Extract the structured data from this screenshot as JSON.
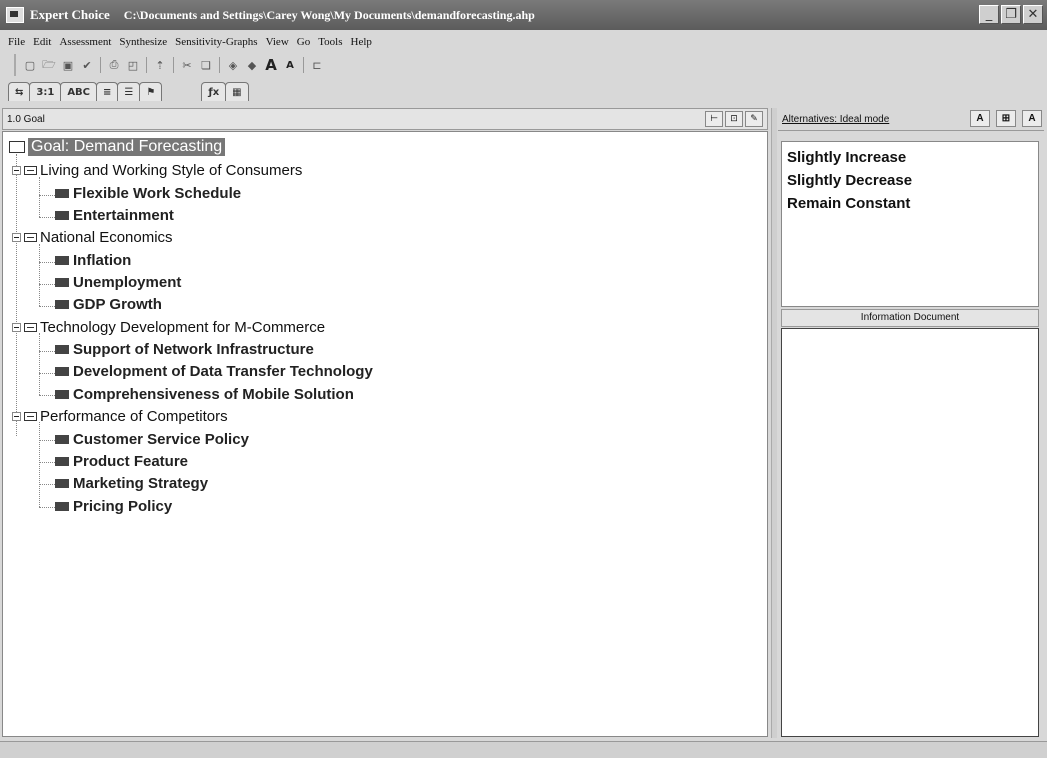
{
  "window": {
    "app_name": "Expert Choice",
    "file_path": "C:\\Documents and Settings\\Carey Wong\\My Documents\\demandforecasting.ahp",
    "buttons": {
      "minimize": "_",
      "restore": "❐",
      "close": "✕"
    }
  },
  "menu": [
    "File",
    "Edit",
    "Assessment",
    "Synthesize",
    "Sensitivity-Graphs",
    "View",
    "Go",
    "Tools",
    "Help"
  ],
  "toolbar_icons": [
    "new-icon",
    "open-icon",
    "save-icon",
    "save-as-icon",
    "print-icon",
    "print-preview-icon",
    "move-up-icon",
    "cut-icon",
    "copy-icon",
    "paste-icon",
    "compare-icon",
    "increase-font-icon",
    "decrease-font-icon",
    "insert-node-icon"
  ],
  "tabs": [
    {
      "label": "⇆",
      "icon": "hierarchy-tab-icon"
    },
    {
      "label": "3:1",
      "icon": ""
    },
    {
      "label": "ABC",
      "icon": ""
    },
    {
      "label": "≡",
      "icon": ""
    },
    {
      "label": "☰",
      "icon": ""
    },
    {
      "label": "⚑",
      "icon": ""
    },
    {
      "label": "ƒx",
      "icon": "formula-icon"
    },
    {
      "label": "▦",
      "icon": "grid-icon"
    }
  ],
  "model_view": {
    "header": "1.0 Goal",
    "goal": "Goal: Demand Forecasting",
    "criteria": [
      {
        "label": "Living and Working Style of Consumers",
        "children": [
          "Flexible Work Schedule",
          "Entertainment"
        ]
      },
      {
        "label": "National Economics",
        "children": [
          "Inflation",
          "Unemployment",
          "GDP Growth"
        ]
      },
      {
        "label": "Technology Development for M-Commerce",
        "children": [
          "Support of Network Infrastructure",
          "Development of Data Transfer Technology",
          "Comprehensiveness of Mobile Solution"
        ]
      },
      {
        "label": "Performance of Competitors",
        "children": [
          "Customer Service Policy",
          "Product Feature",
          "Marketing Strategy",
          "Pricing Policy"
        ]
      }
    ]
  },
  "alternatives": {
    "header": "Alternatives: Ideal mode",
    "items": [
      "Slightly Increase",
      "Slightly Decrease",
      "Remain Constant"
    ]
  },
  "info_document": {
    "header": "Information Document"
  }
}
